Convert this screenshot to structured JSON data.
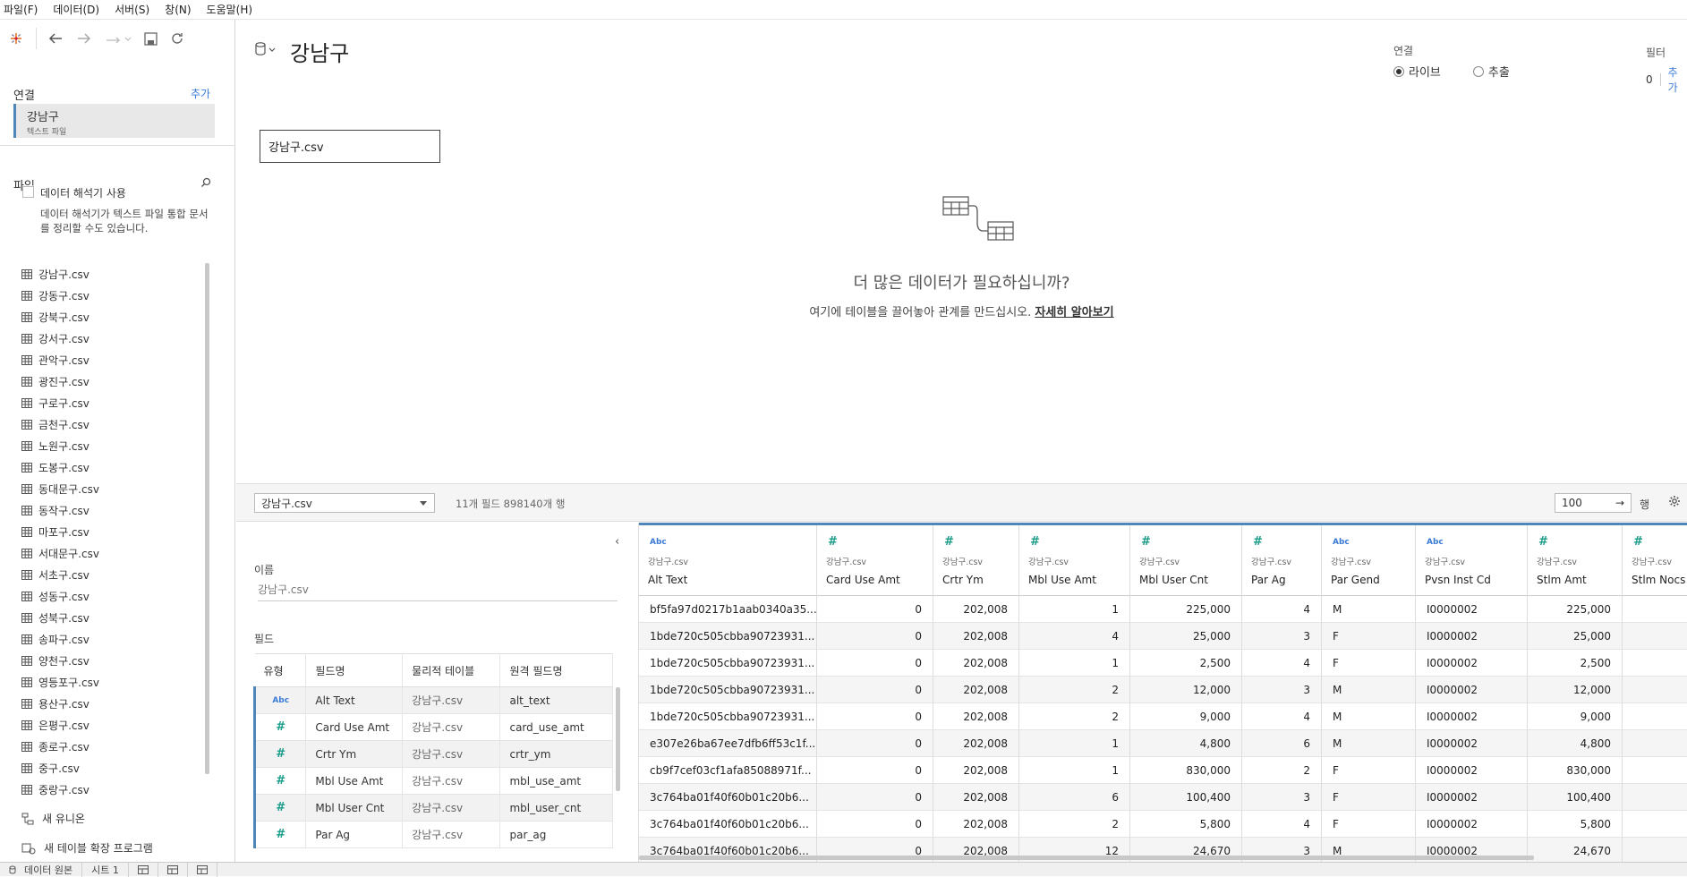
{
  "menu": [
    "파일(F)",
    "데이터(D)",
    "서버(S)",
    "창(N)",
    "도움말(H)"
  ],
  "left": {
    "connections_label": "연결",
    "add_label": "추가",
    "connection": {
      "name": "강남구",
      "type": "텍스트 파일"
    },
    "files_label": "파일",
    "interpreter_label": "데이터 해석기 사용",
    "interpreter_desc": "데이터 해석기가 텍스트 파일 통합 문서를 정리할 수도 있습니다.",
    "files": [
      "강남구.csv",
      "강동구.csv",
      "강북구.csv",
      "강서구.csv",
      "관악구.csv",
      "광진구.csv",
      "구로구.csv",
      "금천구.csv",
      "노원구.csv",
      "도봉구.csv",
      "동대문구.csv",
      "동작구.csv",
      "마포구.csv",
      "서대문구.csv",
      "서초구.csv",
      "성동구.csv",
      "성북구.csv",
      "송파구.csv",
      "양천구.csv",
      "영등포구.csv",
      "용산구.csv",
      "은평구.csv",
      "종로구.csv",
      "중구.csv",
      "중랑구.csv"
    ],
    "new_union": "새 유니온",
    "new_extension": "새 테이블 확장 프로그램"
  },
  "canvas": {
    "title": "강남구",
    "connection_label": "연결",
    "live_label": "라이브",
    "extract_label": "추출",
    "filter_label": "필터",
    "filter_count": "0",
    "filter_add": "추가",
    "table_card": "강남구.csv",
    "more_title": "더 많은 데이터가 필요하십니까?",
    "more_sub": "여기에 테이블을 끌어놓아 관계를 만드십시오.",
    "more_link": "자세히 알아보기"
  },
  "gridbar": {
    "table_select": "강남구.csv",
    "field_count": "11개 필드 898140개 행",
    "rows_value": "100",
    "rows_go": "→",
    "rows_label": "행"
  },
  "meta": {
    "collapse": "‹",
    "name_label": "이름",
    "name_value": "강남구.csv",
    "fields_label": "필드",
    "headers": [
      "유형",
      "필드명",
      "물리적 테이블",
      "원격 필드명"
    ],
    "rows": [
      {
        "type": "Abc",
        "name": "Alt Text",
        "table": "강남구.csv",
        "remote": "alt_text"
      },
      {
        "type": "#",
        "name": "Card Use Amt",
        "table": "강남구.csv",
        "remote": "card_use_amt"
      },
      {
        "type": "#",
        "name": "Crtr Ym",
        "table": "강남구.csv",
        "remote": "crtr_ym"
      },
      {
        "type": "#",
        "name": "Mbl Use Amt",
        "table": "강남구.csv",
        "remote": "mbl_use_amt"
      },
      {
        "type": "#",
        "name": "Mbl User Cnt",
        "table": "강남구.csv",
        "remote": "mbl_user_cnt"
      },
      {
        "type": "#",
        "name": "Par Ag",
        "table": "강남구.csv",
        "remote": "par_ag"
      }
    ]
  },
  "grid": {
    "columns": [
      {
        "type": "Abc",
        "source": "강남구.csv",
        "name": "Alt Text",
        "align": "txt",
        "values": [
          "bf5fa97d0217b1aab0340a35...",
          "1bde720c505cbba90723931...",
          "1bde720c505cbba90723931...",
          "1bde720c505cbba90723931...",
          "1bde720c505cbba90723931...",
          "e307e26ba67ee7dfb6ff53c1f...",
          "cb9f7cef03cf1afa85088971f...",
          "3c764ba01f40f60b01c20b6...",
          "3c764ba01f40f60b01c20b6...",
          "3c764ba01f40f60b01c20b6..."
        ]
      },
      {
        "type": "#",
        "source": "강남구.csv",
        "name": "Card Use Amt",
        "align": "r",
        "values": [
          "0",
          "0",
          "0",
          "0",
          "0",
          "0",
          "0",
          "0",
          "0",
          "0"
        ]
      },
      {
        "type": "#",
        "source": "강남구.csv",
        "name": "Crtr Ym",
        "align": "r",
        "values": [
          "202,008",
          "202,008",
          "202,008",
          "202,008",
          "202,008",
          "202,008",
          "202,008",
          "202,008",
          "202,008",
          "202,008"
        ]
      },
      {
        "type": "#",
        "source": "강남구.csv",
        "name": "Mbl Use Amt",
        "align": "r",
        "values": [
          "1",
          "4",
          "1",
          "2",
          "2",
          "1",
          "1",
          "6",
          "2",
          "12"
        ]
      },
      {
        "type": "#",
        "source": "강남구.csv",
        "name": "Mbl User Cnt",
        "align": "r",
        "values": [
          "225,000",
          "25,000",
          "2,500",
          "12,000",
          "9,000",
          "4,800",
          "830,000",
          "100,400",
          "5,800",
          "24,670"
        ]
      },
      {
        "type": "#",
        "source": "강남구.csv",
        "name": "Par Ag",
        "align": "r",
        "values": [
          "4",
          "3",
          "4",
          "3",
          "4",
          "6",
          "2",
          "3",
          "4",
          "3"
        ]
      },
      {
        "type": "Abc",
        "source": "강남구.csv",
        "name": "Par Gend",
        "align": "txt",
        "values": [
          "M",
          "F",
          "F",
          "M",
          "M",
          "M",
          "F",
          "F",
          "F",
          "M"
        ]
      },
      {
        "type": "Abc",
        "source": "강남구.csv",
        "name": "Pvsn Inst Cd",
        "align": "txt",
        "values": [
          "I0000002",
          "I0000002",
          "I0000002",
          "I0000002",
          "I0000002",
          "I0000002",
          "I0000002",
          "I0000002",
          "I0000002",
          "I0000002"
        ]
      },
      {
        "type": "#",
        "source": "강남구.csv",
        "name": "Stlm Amt",
        "align": "r",
        "values": [
          "225,000",
          "25,000",
          "2,500",
          "12,000",
          "9,000",
          "4,800",
          "830,000",
          "100,400",
          "5,800",
          "24,670"
        ]
      },
      {
        "type": "#",
        "source": "강남구.csv",
        "name": "Stlm Nocs",
        "align": "r",
        "values": [
          "",
          "",
          "",
          "",
          "",
          "",
          "",
          "",
          "",
          ""
        ]
      }
    ]
  },
  "bottom_tabs": [
    "데이터 원본",
    "시트 1"
  ],
  "colors": {
    "accent": "#4e86b8",
    "string_type": "#3a7bd5",
    "number_type": "#1a9c8a"
  }
}
